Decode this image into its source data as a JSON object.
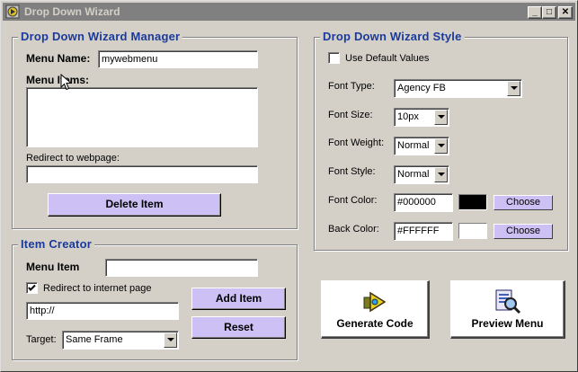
{
  "window": {
    "title": "Drop Down Wizard",
    "minimize": "_",
    "maximize": "□",
    "close": "✕"
  },
  "manager": {
    "title": "Drop Down Wizard Manager",
    "menu_name_label": "Menu Name:",
    "menu_name_value": "mywebmenu",
    "menu_items_label": "Menu Items:",
    "menu_items": [],
    "redirect_label": "Redirect to webpage:",
    "redirect_value": "",
    "delete_button": "Delete Item"
  },
  "creator": {
    "title": "Item Creator",
    "menu_item_label": "Menu Item",
    "menu_item_value": "",
    "redirect_checkbox_label": "Redirect to internet page",
    "redirect_checked": true,
    "url_value": "http://",
    "target_label": "Target:",
    "target_value": "Same Frame",
    "add_button": "Add Item",
    "reset_button": "Reset"
  },
  "style": {
    "title": "Drop Down Wizard Style",
    "use_default_label": "Use Default Values",
    "use_default_checked": false,
    "font_type_label": "Font Type:",
    "font_type_value": "Agency FB",
    "font_size_label": "Font Size:",
    "font_size_value": "10px",
    "font_weight_label": "Font Weight:",
    "font_weight_value": "Normal",
    "font_style_label": "Font Style:",
    "font_style_value": "Normal",
    "font_color_label": "Font Color:",
    "font_color_value": "#000000",
    "font_color_swatch": "#000000",
    "font_color_choose": "Choose",
    "back_color_label": "Back Color:",
    "back_color_value": "#FFFFFF",
    "back_color_swatch": "#FFFFFF",
    "back_color_choose": "Choose"
  },
  "actions": {
    "generate_label": "Generate Code",
    "preview_label": "Preview Menu"
  },
  "colors": {
    "group_title": "#1a3a9c",
    "button_purple": "#ccc0f4",
    "titlebar_inactive": "#808080"
  }
}
